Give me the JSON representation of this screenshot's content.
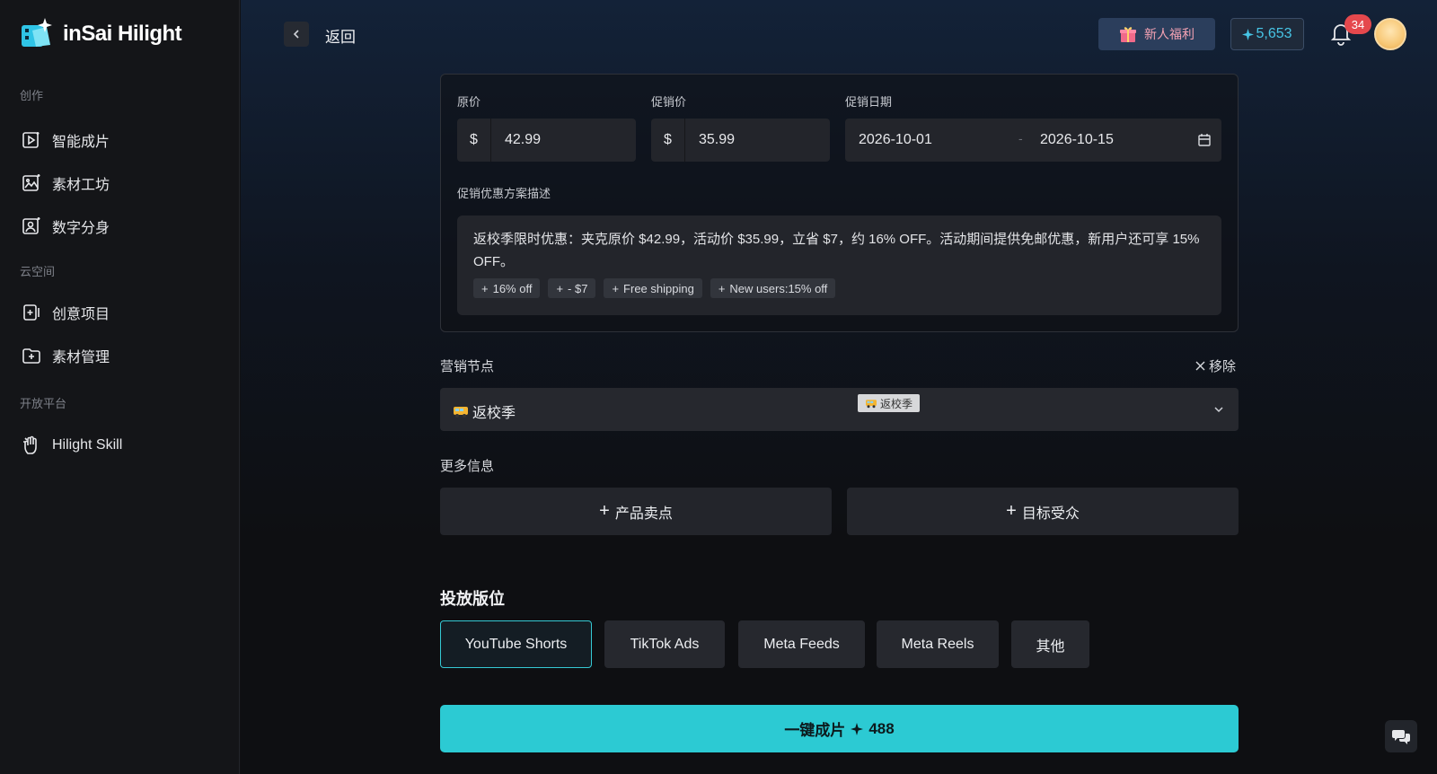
{
  "app": {
    "logo_text": "inSai Hilight"
  },
  "sidebar": {
    "sections": [
      {
        "label": "创作",
        "items": [
          {
            "label": "智能成片",
            "icon": "video-play-icon"
          },
          {
            "label": "素材工坊",
            "icon": "image-sparkle-icon"
          },
          {
            "label": "数字分身",
            "icon": "avatar-sparkle-icon"
          }
        ]
      },
      {
        "label": "云空间",
        "items": [
          {
            "label": "创意项目",
            "icon": "project-plus-icon"
          },
          {
            "label": "素材管理",
            "icon": "folder-plus-icon"
          }
        ]
      },
      {
        "label": "开放平台",
        "items": [
          {
            "label": "Hilight Skill",
            "icon": "skill-hand-icon"
          }
        ]
      }
    ]
  },
  "topbar": {
    "back_label": "返回",
    "gift_label": "新人福利",
    "credits": "5,653",
    "notification_count": "34"
  },
  "pricing": {
    "original_label": "原价",
    "original_currency": "$",
    "original_value": "42.99",
    "promo_label": "促销价",
    "promo_currency": "$",
    "promo_value": "35.99",
    "date_label": "促销日期",
    "date_start": "2026-10-01",
    "date_sep": "-",
    "date_end": "2026-10-15",
    "desc_label": "促销优惠方案描述",
    "desc_text": "返校季限时优惠：夹克原价 $42.99，活动价 $35.99，立省 $7，约 16% OFF。活动期间提供免邮优惠，新用户还可享 15% OFF。",
    "chips": [
      "16% off",
      "- $7",
      "Free shipping",
      "New users:15% off"
    ]
  },
  "marketing_node": {
    "label": "营销节点",
    "remove_label": "移除",
    "selected": "返校季",
    "tooltip": "返校季"
  },
  "more_info": {
    "label": "更多信息",
    "selling_points_label": "产品卖点",
    "target_audience_label": "目标受众"
  },
  "placement": {
    "title": "投放版位",
    "options": [
      "YouTube Shorts",
      "TikTok Ads",
      "Meta Feeds",
      "Meta Reels",
      "其他"
    ],
    "active_index": 0
  },
  "cta": {
    "label": "一键成片",
    "cost": "488"
  },
  "colors": {
    "accent": "#2ccad3",
    "credit": "#47c5e6",
    "badge": "#e5484d"
  }
}
